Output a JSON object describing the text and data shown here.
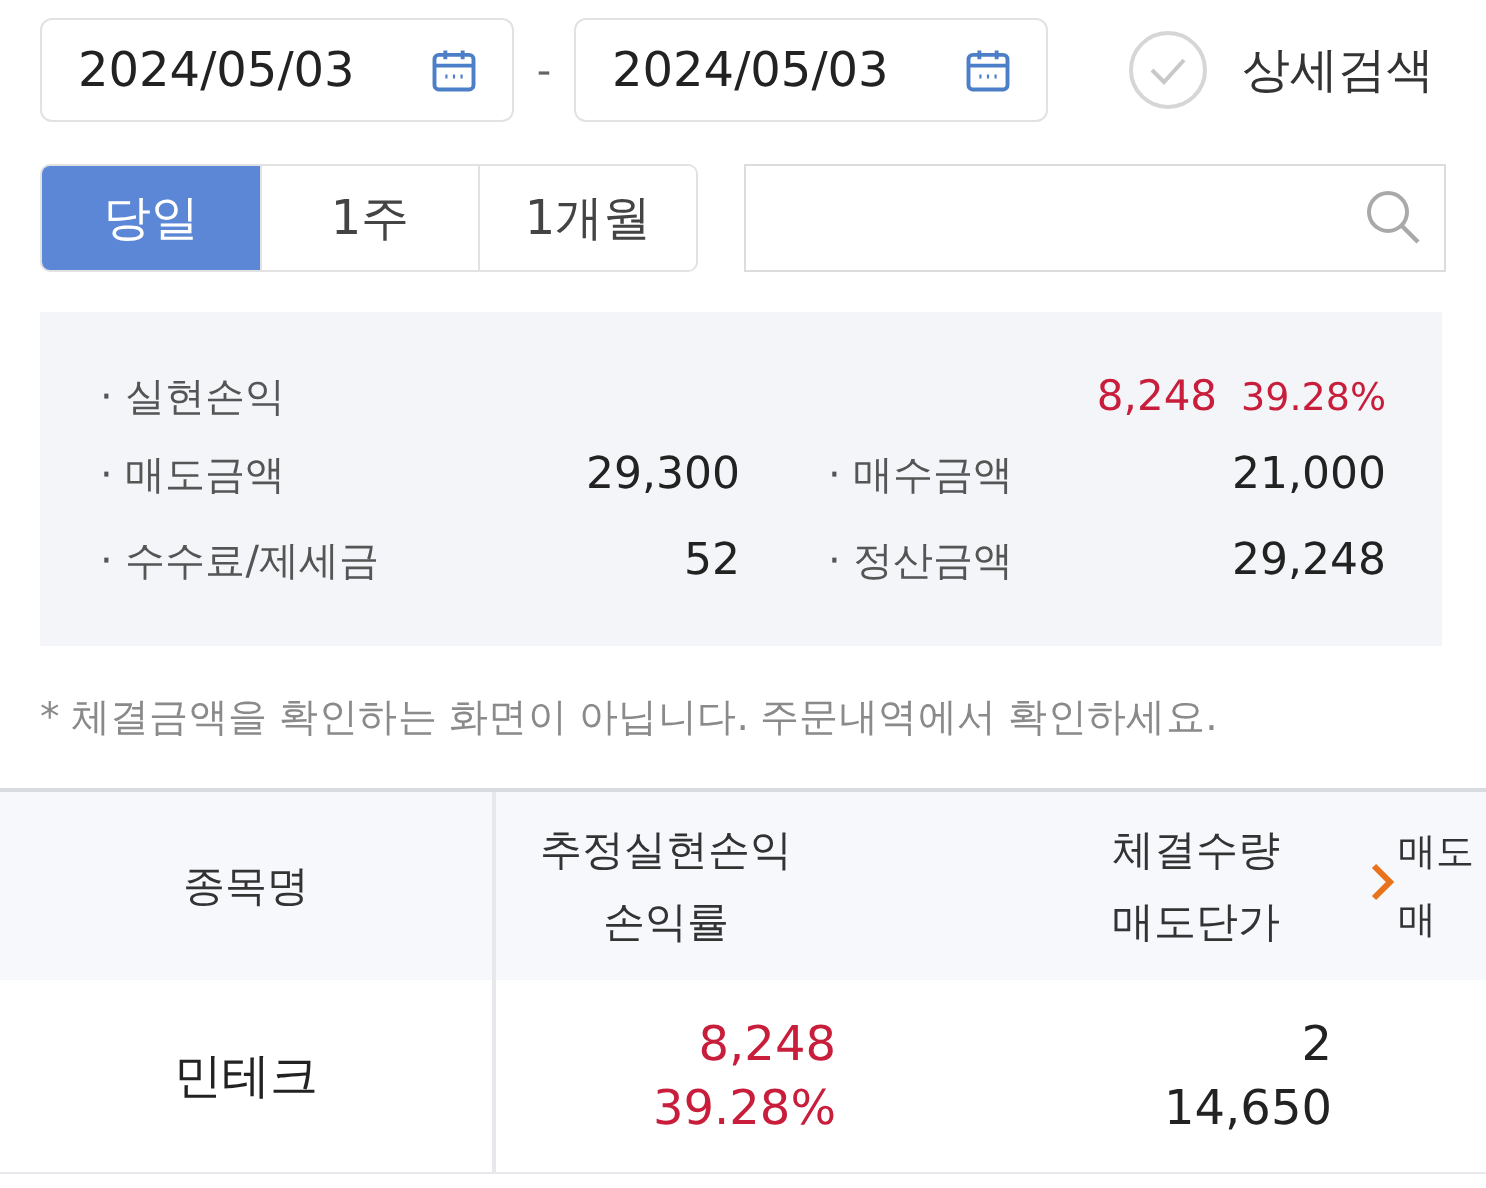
{
  "date_range": {
    "start": "2024/05/03",
    "separator": "-",
    "end": "2024/05/03"
  },
  "detail_search": {
    "label": "상세검색",
    "checked": false
  },
  "period_tabs": [
    {
      "label": "당일",
      "selected": true
    },
    {
      "label": "1주",
      "selected": false
    },
    {
      "label": "1개월",
      "selected": false
    }
  ],
  "summary": {
    "realized": {
      "label": "· 실현손익",
      "value": "8,248",
      "rate": "39.28%"
    },
    "items": [
      {
        "label": "· 매도금액",
        "value": "29,300"
      },
      {
        "label": "· 매수금액",
        "value": "21,000"
      },
      {
        "label": "· 수수료/제세금",
        "value": "52"
      },
      {
        "label": "· 정산금액",
        "value": "29,248"
      }
    ]
  },
  "notice": "* 체결금액을 확인하는 화면이 아닙니다. 주문내역에서 확인하세요.",
  "table": {
    "columns": [
      {
        "lines": [
          "종목명"
        ]
      },
      {
        "lines": [
          "추정실현손익",
          "손익률"
        ]
      },
      {
        "lines": [
          "체결수량",
          "매도단가"
        ]
      },
      {
        "lines": [
          "매도",
          "매"
        ]
      }
    ],
    "rows": [
      {
        "name": "민테크",
        "profit": "8,248",
        "rate": "39.28%",
        "quantity": "2",
        "sell_price": "14,650"
      }
    ]
  }
}
